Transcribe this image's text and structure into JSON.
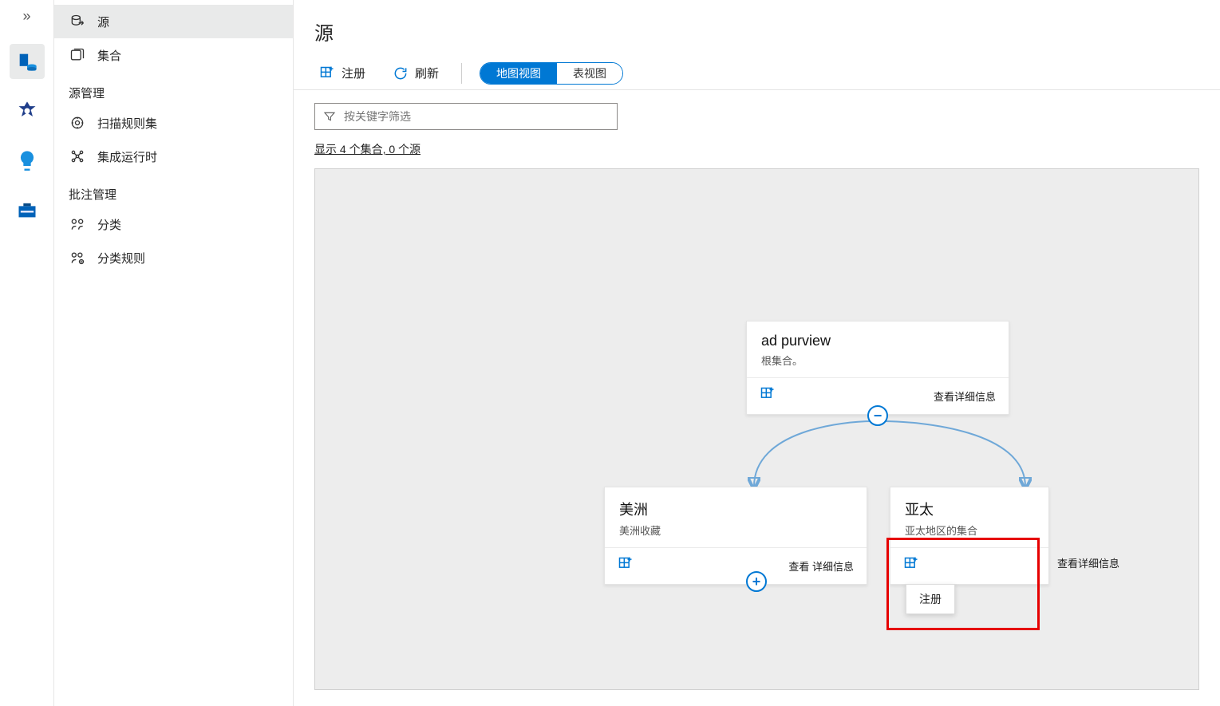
{
  "iconRail": {
    "expand": "»",
    "items": [
      {
        "name": "database-icon"
      },
      {
        "name": "catalog-icon"
      },
      {
        "name": "lightbulb-icon"
      },
      {
        "name": "toolbox-icon"
      }
    ]
  },
  "sidebar": {
    "items": [
      {
        "label": "源",
        "icon": "source-icon",
        "selected": true
      },
      {
        "label": "集合",
        "icon": "collection-icon"
      }
    ],
    "group1_title": "源管理",
    "group1_items": [
      {
        "label": "扫描规则集",
        "icon": "scan-rules-icon"
      },
      {
        "label": "集成运行时",
        "icon": "integration-runtime-icon"
      }
    ],
    "group2_title": "批注管理",
    "group2_items": [
      {
        "label": "分类",
        "icon": "classification-icon"
      },
      {
        "label": "分类规则",
        "icon": "classification-rules-icon"
      }
    ]
  },
  "page": {
    "title": "源"
  },
  "toolbar": {
    "register": "注册",
    "refresh": "刷新",
    "mapView": "地图视图",
    "tableView": "表视图"
  },
  "filter": {
    "placeholder": "按关键字筛选"
  },
  "countText": "显示 4 个集合, 0 个源",
  "nodes": {
    "root": {
      "title": "ad purview",
      "subtitle": "根集合。",
      "details": "查看详细信息"
    },
    "americas": {
      "title": "美洲",
      "subtitle": "美洲收藏",
      "details": "查看 详细信息"
    },
    "apac": {
      "title": "亚太",
      "subtitle": "亚太地区的集合",
      "details": "查看详细信息"
    }
  },
  "popup": {
    "register": "注册"
  }
}
